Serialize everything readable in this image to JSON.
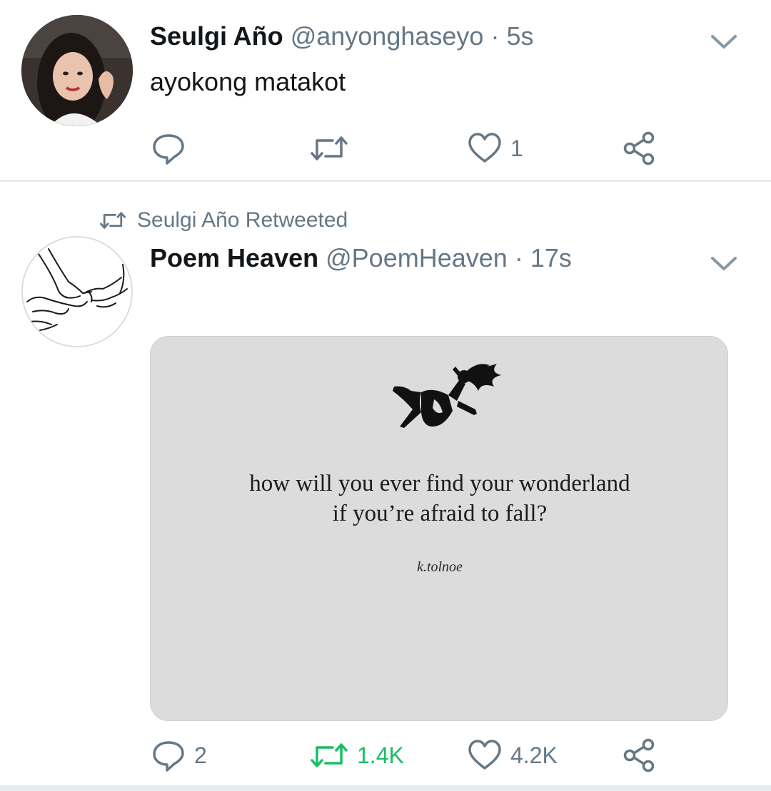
{
  "tweets": [
    {
      "name": "Seulgi Año",
      "handle": "@anyonghaseyo",
      "separator": "·",
      "time": "5s",
      "text": "ayokong matakot",
      "reply_count": "",
      "retweet_count": "",
      "like_count": "1"
    },
    {
      "retweeted_by": "Seulgi Año Retweeted",
      "name": "Poem Heaven",
      "handle": "@PoemHeaven",
      "separator": "·",
      "time": "17s",
      "image_text_line1": "how will you ever find your wonderland",
      "image_text_line2": "if you’re afraid to fall?",
      "image_author": "k.tolnoe",
      "reply_count": "2",
      "retweet_count": "1.4K",
      "like_count": "4.2K"
    }
  ],
  "colors": {
    "text": "#14171a",
    "secondary": "#657786",
    "retweet_active": "#17bf63",
    "divider": "#e6ecf0"
  },
  "icons": [
    "chevron-down-icon",
    "reply-icon",
    "retweet-icon",
    "like-icon",
    "share-icon"
  ]
}
